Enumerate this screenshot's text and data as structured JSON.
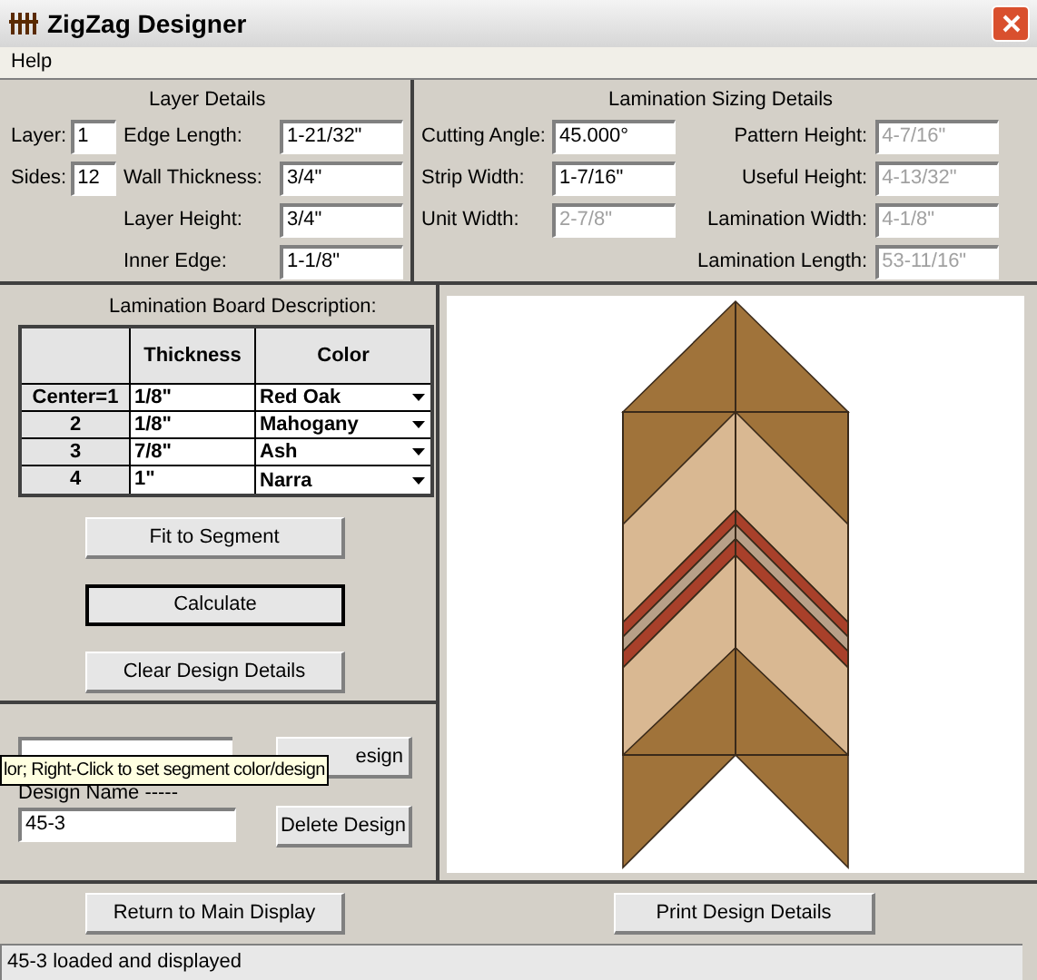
{
  "window": {
    "title": "ZigZag Designer"
  },
  "menu": [
    "Help"
  ],
  "layer_details": {
    "title": "Layer Details",
    "small_fields": [
      {
        "label": "Layer:",
        "value": "1"
      },
      {
        "label": "Sides:",
        "value": "12"
      }
    ],
    "fields": [
      {
        "label": "Edge Length:",
        "value": "1-21/32\""
      },
      {
        "label": "Wall Thickness:",
        "value": "3/4\""
      },
      {
        "label": "Layer Height:",
        "value": "3/4\""
      },
      {
        "label": "Inner Edge:",
        "value": "1-1/8\""
      }
    ]
  },
  "lamination_sizing": {
    "title": "Lamination Sizing Details",
    "fields_left": [
      {
        "label": "Cutting Angle:",
        "value": "45.000°",
        "disabled": false
      },
      {
        "label": "Strip Width:",
        "value": "1-7/16\"",
        "disabled": false
      },
      {
        "label": "Unit Width:",
        "value": "2-7/8\"",
        "disabled": true
      }
    ],
    "fields_right": [
      {
        "label": "Pattern Height:",
        "value": "4-7/16\"",
        "disabled": true
      },
      {
        "label": "Useful Height:",
        "value": "4-13/32\"",
        "disabled": true
      },
      {
        "label": "Lamination Width:",
        "value": "4-1/8\"",
        "disabled": true
      },
      {
        "label": "Lamination Length:",
        "value": "53-11/16\"",
        "disabled": true
      }
    ]
  },
  "board_table": {
    "title": "Lamination Board Description:",
    "columns": [
      "Thickness",
      "Color"
    ],
    "rows": [
      {
        "label": "Center=1",
        "thickness": "1/8\"",
        "wood": "Red Oak"
      },
      {
        "label": "2",
        "thickness": "1/8\"",
        "wood": "Mahogany"
      },
      {
        "label": "3",
        "thickness": "7/8\"",
        "wood": "Ash"
      },
      {
        "label": "4",
        "thickness": "1\"",
        "wood": "Narra"
      }
    ]
  },
  "board_buttons": [
    {
      "label": "Fit to Segment",
      "focused": false
    },
    {
      "label": "Calculate",
      "focused": true
    },
    {
      "label": "Clear Design Details",
      "focused": false
    }
  ],
  "design": {
    "save_button": "esign",
    "name_label": "Design Name -----",
    "name_value": "45-3",
    "delete_button": "Delete Design"
  },
  "tooltip": "lor; Right-Click to set segment color/design",
  "footer_buttons": [
    "Return to Main Display",
    "Print Design Details"
  ],
  "status_bar": "45-3 loaded and displayed"
}
